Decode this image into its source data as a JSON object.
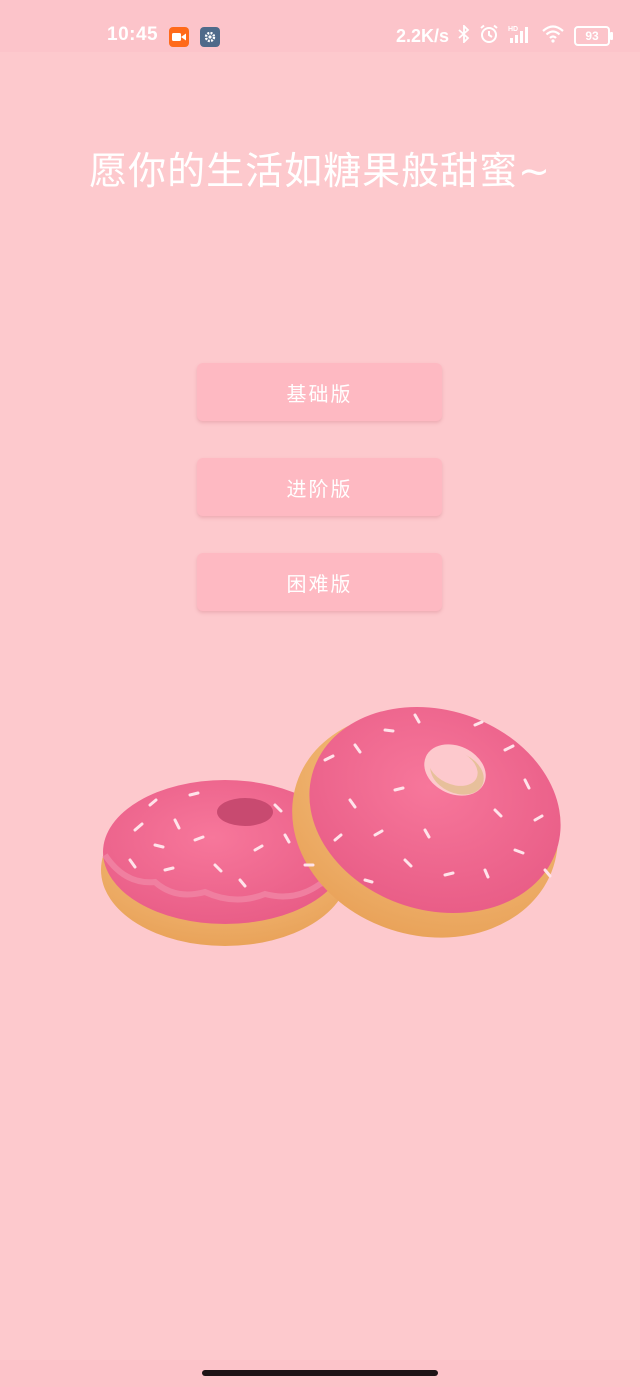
{
  "status_bar": {
    "time": "10:45",
    "apps": [
      "video-camera-icon",
      "gear-icon"
    ],
    "net_speed": "2.2K/s",
    "icons": [
      "bluetooth-icon",
      "alarm-icon",
      "signal-hd-icon",
      "wifi-icon"
    ],
    "battery": "93"
  },
  "main": {
    "title": "愿你的生活如糖果般甜蜜~",
    "buttons": {
      "basic": "基础版",
      "advanced": "进阶版",
      "hard": "困难版"
    },
    "image": "donuts-illustration"
  },
  "colors": {
    "background": "#fdc9cd",
    "button": "#feb9c2",
    "icing": "#f06a92",
    "dough": "#f2b56a"
  }
}
